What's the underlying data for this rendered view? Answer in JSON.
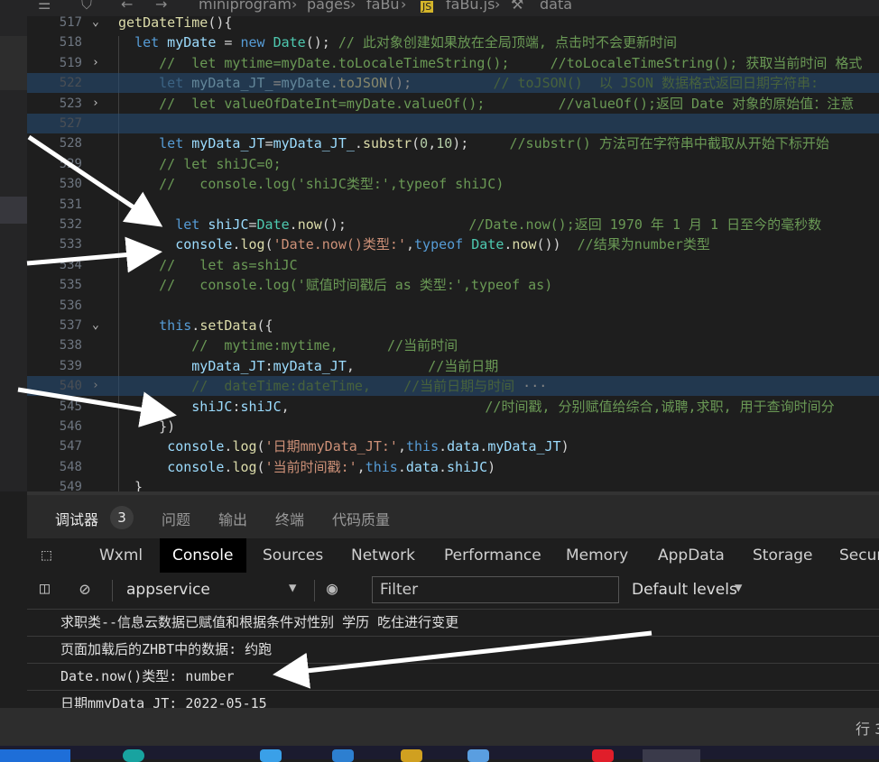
{
  "breadcrumb": {
    "folder1": "miniprogram",
    "folder2": "pages",
    "folder3": "faBu",
    "file": "faBu.js",
    "symbol": "data"
  },
  "code_lines": [
    {
      "num": "517",
      "fold": "⌄",
      "segments": [
        [
          "fn",
          "getDateTime"
        ],
        [
          "plain",
          "(){"
        ]
      ]
    },
    {
      "num": "518",
      "fold": "",
      "segments": [
        [
          "plain",
          "  "
        ],
        [
          "kw",
          "let"
        ],
        [
          "var",
          " myDate"
        ],
        [
          "plain",
          " = "
        ],
        [
          "kw",
          "new"
        ],
        [
          "cls",
          " Date"
        ],
        [
          "plain",
          "(); "
        ],
        [
          "cm",
          "// 此对象创建如果放在全局顶端, 点击时不会更新时间"
        ]
      ]
    },
    {
      "num": "519",
      "fold": "›",
      "segments": [
        [
          "cm",
          "     //  let mytime=myDate.toLocaleTimeString();     //toLocaleTimeString(); 获取当前时间 格式"
        ]
      ]
    },
    {
      "num": "522",
      "fold": "",
      "segments": [
        [
          "plain",
          "     "
        ],
        [
          "kw",
          "let"
        ],
        [
          "var",
          " myData_JT_"
        ],
        [
          "plain",
          "="
        ],
        [
          "var",
          "myDate"
        ],
        [
          "plain",
          "."
        ],
        [
          "fn",
          "toJSON"
        ],
        [
          "plain",
          "();          "
        ],
        [
          "cm",
          "// toJSON()  以 JSON 数据格式返回日期字符串:"
        ]
      ]
    },
    {
      "num": "523",
      "fold": "›",
      "segments": [
        [
          "cm",
          "     //  let valueOfDateInt=myDate.valueOf();         //valueOf();返回 Date 对象的原始值：注意"
        ]
      ]
    },
    {
      "num": "527",
      "fold": "",
      "segments": []
    },
    {
      "num": "528",
      "fold": "",
      "segments": [
        [
          "plain",
          "     "
        ],
        [
          "kw",
          "let"
        ],
        [
          "var",
          " myData_JT"
        ],
        [
          "plain",
          "="
        ],
        [
          "var",
          "myData_JT_"
        ],
        [
          "plain",
          "."
        ],
        [
          "fn",
          "substr"
        ],
        [
          "plain",
          "("
        ],
        [
          "num",
          "0"
        ],
        [
          "plain",
          ","
        ],
        [
          "num",
          "10"
        ],
        [
          "plain",
          ");     "
        ],
        [
          "cm",
          "//substr() 方法可在字符串中截取从开始下标开始"
        ]
      ]
    },
    {
      "num": "529",
      "fold": "",
      "segments": [
        [
          "cm",
          "     // let shiJC=0;"
        ]
      ]
    },
    {
      "num": "530",
      "fold": "",
      "segments": [
        [
          "cm",
          "     //   console.log('shiJC类型:',typeof shiJC)"
        ]
      ]
    },
    {
      "num": "531",
      "fold": "",
      "segments": []
    },
    {
      "num": "532",
      "fold": "",
      "segments": [
        [
          "plain",
          "       "
        ],
        [
          "kw",
          "let"
        ],
        [
          "var",
          " shiJC"
        ],
        [
          "plain",
          "="
        ],
        [
          "cls",
          "Date"
        ],
        [
          "plain",
          "."
        ],
        [
          "fn",
          "now"
        ],
        [
          "plain",
          "();               "
        ],
        [
          "cm",
          "//Date.now();返回 1970 年 1 月 1 日至今的毫秒数"
        ]
      ]
    },
    {
      "num": "533",
      "fold": "",
      "segments": [
        [
          "plain",
          "       "
        ],
        [
          "var",
          "console"
        ],
        [
          "plain",
          "."
        ],
        [
          "fn",
          "log"
        ],
        [
          "plain",
          "("
        ],
        [
          "str",
          "'Date.now()类型:'"
        ],
        [
          "plain",
          ","
        ],
        [
          "kw",
          "typeof"
        ],
        [
          "cls",
          " Date"
        ],
        [
          "plain",
          "."
        ],
        [
          "fn",
          "now"
        ],
        [
          "plain",
          "())  "
        ],
        [
          "cm",
          "//结果为number类型"
        ]
      ]
    },
    {
      "num": "534",
      "fold": "",
      "segments": [
        [
          "cm",
          "     //   let as=shiJC"
        ]
      ]
    },
    {
      "num": "535",
      "fold": "",
      "segments": [
        [
          "cm",
          "     //   console.log('赋值时间戳后 as 类型:',typeof as)"
        ]
      ]
    },
    {
      "num": "536",
      "fold": "",
      "segments": []
    },
    {
      "num": "537",
      "fold": "⌄",
      "segments": [
        [
          "plain",
          "     "
        ],
        [
          "kw",
          "this"
        ],
        [
          "plain",
          "."
        ],
        [
          "fn",
          "setData"
        ],
        [
          "plain",
          "({"
        ]
      ]
    },
    {
      "num": "538",
      "fold": "",
      "segments": [
        [
          "cm",
          "         //  mytime:mytime,      //当前时间"
        ]
      ]
    },
    {
      "num": "539",
      "fold": "",
      "segments": [
        [
          "plain",
          "         "
        ],
        [
          "var",
          "myData_JT"
        ],
        [
          "plain",
          ":"
        ],
        [
          "var",
          "myData_JT"
        ],
        [
          "plain",
          ",         "
        ],
        [
          "cm",
          "//当前日期"
        ]
      ]
    },
    {
      "num": "540",
      "fold": "›",
      "segments": [
        [
          "cm",
          "         //  dateTime:dateTime,    //当前日期与时间"
        ],
        [
          "plain",
          " ···"
        ]
      ]
    },
    {
      "num": "545",
      "fold": "",
      "segments": [
        [
          "plain",
          "         "
        ],
        [
          "var",
          "shiJC"
        ],
        [
          "plain",
          ":"
        ],
        [
          "var",
          "shiJC"
        ],
        [
          "plain",
          ",                        "
        ],
        [
          "cm",
          "//时间戳, 分别赋值给综合,诚聘,求职, 用于查询时间分"
        ]
      ]
    },
    {
      "num": "546",
      "fold": "",
      "segments": [
        [
          "plain",
          "     })"
        ]
      ]
    },
    {
      "num": "547",
      "fold": "",
      "segments": [
        [
          "plain",
          "      "
        ],
        [
          "var",
          "console"
        ],
        [
          "plain",
          "."
        ],
        [
          "fn",
          "log"
        ],
        [
          "plain",
          "("
        ],
        [
          "str",
          "'日期mmyData_JT:'"
        ],
        [
          "plain",
          ","
        ],
        [
          "kw",
          "this"
        ],
        [
          "plain",
          "."
        ],
        [
          "var",
          "data"
        ],
        [
          "plain",
          "."
        ],
        [
          "var",
          "myData_JT"
        ],
        [
          "plain",
          ")"
        ]
      ]
    },
    {
      "num": "548",
      "fold": "",
      "segments": [
        [
          "plain",
          "      "
        ],
        [
          "var",
          "console"
        ],
        [
          "plain",
          "."
        ],
        [
          "fn",
          "log"
        ],
        [
          "plain",
          "("
        ],
        [
          "str",
          "'当前时间戳:'"
        ],
        [
          "plain",
          ","
        ],
        [
          "kw",
          "this"
        ],
        [
          "plain",
          "."
        ],
        [
          "var",
          "data"
        ],
        [
          "plain",
          "."
        ],
        [
          "var",
          "shiJC"
        ],
        [
          "plain",
          ")"
        ]
      ]
    },
    {
      "num": "549",
      "fold": "",
      "segments": [
        [
          "plain",
          "  }"
        ]
      ]
    }
  ],
  "panel_tabs": {
    "debugger": "调试器",
    "badge": "3",
    "issues": "问题",
    "output": "输出",
    "terminal": "终端",
    "quality": "代码质量"
  },
  "devtools_tabs": [
    "Wxml",
    "Console",
    "Sources",
    "Network",
    "Performance",
    "Memory",
    "AppData",
    "Storage",
    "Secur"
  ],
  "console_toolbar": {
    "context": "appservice",
    "filter_placeholder": "Filter",
    "levels": "Default levels"
  },
  "console_lines": [
    "求职类--信息云数据已赋值和根据条件对性别 学历 吃住进行变更",
    "页面加载后的ZHBT中的数据: 约跑",
    "Date.now()类型: number",
    "日期mmyData_JT: 2022-05-15"
  ],
  "status": {
    "right_text": "行 3"
  },
  "colors": {
    "editor_bg": "#1e1e1e",
    "highlight": "#264f78",
    "arrow": "#ffffff"
  }
}
